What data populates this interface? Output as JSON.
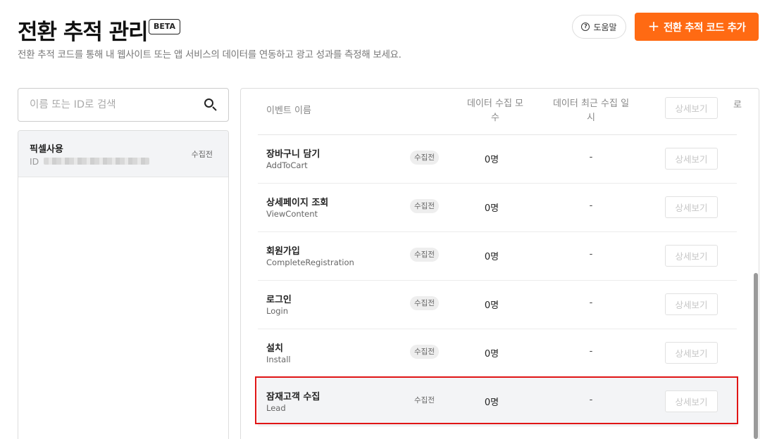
{
  "header": {
    "title": "전환 추적 관리",
    "badge": "BETA",
    "subtitle": "전환 추적 코드를 통해 내 웹사이트 또는 앱 서비스의 데이터를 연동하고 광고 성과를 측정해 보세요.",
    "help_label": "도움말",
    "add_label": "전환 추적 코드 추가",
    "accent_color": "#ff6a13"
  },
  "search": {
    "placeholder": "이름 또는 ID로 검색",
    "value": ""
  },
  "pixels": [
    {
      "name": "픽셀사용",
      "id_label": "ID",
      "status": "수집전"
    }
  ],
  "table": {
    "columns": {
      "name": "이벤트 이름",
      "count": "데이터 수집 모수",
      "recent": "데이터 최근 수집 일시",
      "peek": "로"
    },
    "button_label": "상세보기",
    "rows": [
      {
        "name": "장바구니 담기",
        "code": "AddToCart",
        "status": "수집전",
        "count": "0명",
        "recent": "-",
        "button": "상세보기"
      },
      {
        "name": "상세페이지 조회",
        "code": "ViewContent",
        "status": "수집전",
        "count": "0명",
        "recent": "-",
        "button": "상세보기"
      },
      {
        "name": "회원가입",
        "code": "CompleteRegistration",
        "status": "수집전",
        "count": "0명",
        "recent": "-",
        "button": "상세보기"
      },
      {
        "name": "로그인",
        "code": "Login",
        "status": "수집전",
        "count": "0명",
        "recent": "-",
        "button": "상세보기"
      },
      {
        "name": "설치",
        "code": "Install",
        "status": "수집전",
        "count": "0명",
        "recent": "-",
        "button": "상세보기"
      },
      {
        "name": "잠재고객 수집",
        "code": "Lead",
        "status": "수집전",
        "count": "0명",
        "recent": "-",
        "button": "상세보기"
      }
    ]
  }
}
